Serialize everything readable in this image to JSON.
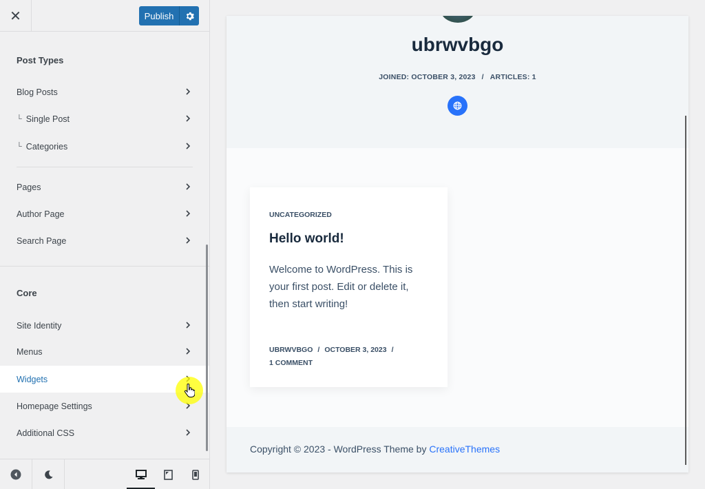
{
  "header": {
    "close_label": "✕",
    "publish_label": "Publish"
  },
  "sections": {
    "post_types_title": "Post Types",
    "core_title": "Core"
  },
  "post_types_items": [
    {
      "label": "Blog Posts"
    },
    {
      "label": "Single Post",
      "prefix": "└"
    },
    {
      "label": "Categories",
      "prefix": "└"
    },
    {
      "label": "Pages"
    },
    {
      "label": "Author Page"
    },
    {
      "label": "Search Page"
    }
  ],
  "core_items": [
    {
      "label": "Site Identity"
    },
    {
      "label": "Menus"
    },
    {
      "label": "Widgets",
      "active": true
    },
    {
      "label": "Homepage Settings"
    },
    {
      "label": "Additional CSS"
    }
  ],
  "preview": {
    "author_name": "ubrwvbgo",
    "joined": "JOINED: OCTOBER 3, 2023",
    "meta_sep": "/",
    "articles": "ARTICLES: 1",
    "post": {
      "category": "UNCATEGORIZED",
      "title": "Hello world!",
      "excerpt": "Welcome to WordPress. This is your first post. Edit or delete it, then start writing!",
      "author": "UBRWVBGO",
      "date": "OCTOBER 3, 2023",
      "comments": "1 COMMENT"
    },
    "footer_text": "Copyright © 2023 - WordPress Theme by ",
    "footer_link": "CreativeThemes"
  },
  "colors": {
    "accent": "#2271b1",
    "theme_accent": "#2872fa",
    "heading": "#192a3d",
    "text": "#3a4f66"
  }
}
